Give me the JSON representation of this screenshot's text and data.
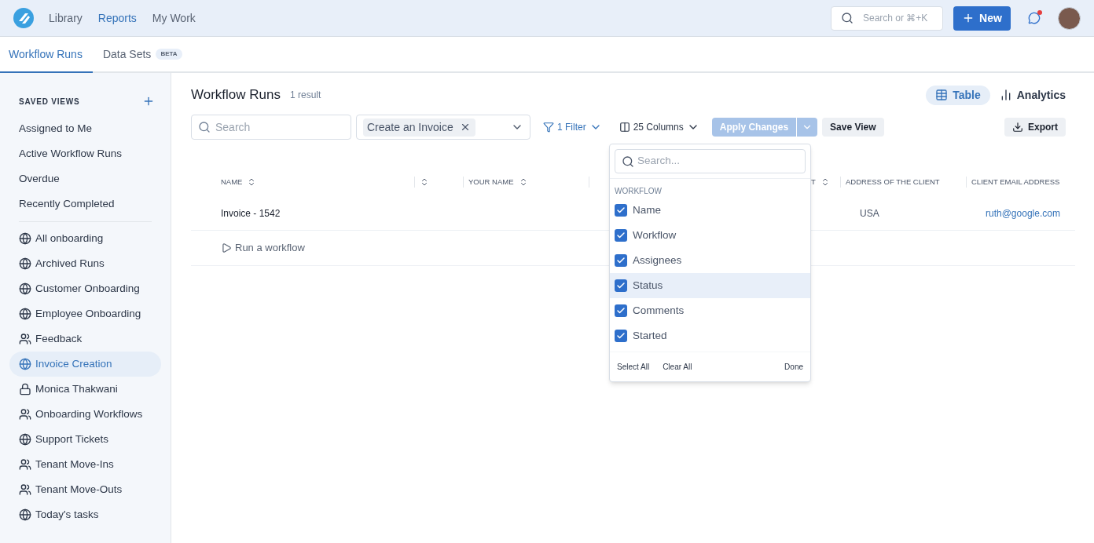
{
  "nav": {
    "items": [
      {
        "label": "Library",
        "selected": false
      },
      {
        "label": "Reports",
        "selected": true
      },
      {
        "label": "My Work",
        "selected": false
      }
    ],
    "search": {
      "placeholder": "Search or ⌘+K"
    },
    "new_button": "New",
    "messages": {
      "unread": true
    }
  },
  "tabs": [
    {
      "label": "Workflow Runs",
      "selected": true
    },
    {
      "label": "Data Sets",
      "selected": false,
      "badge": "BETA"
    }
  ],
  "sidebar": {
    "heading": "SAVED VIEWS",
    "groups": [
      [
        {
          "label": "Assigned to Me",
          "kind": "plain",
          "selected": false
        },
        {
          "label": "Active Workflow Runs",
          "kind": "plain",
          "selected": false
        },
        {
          "label": "Overdue",
          "kind": "plain",
          "selected": false
        },
        {
          "label": "Recently Completed",
          "kind": "plain",
          "selected": false
        }
      ],
      [
        {
          "label": "All onboarding",
          "kind": "globe",
          "selected": false
        },
        {
          "label": "Archived Runs",
          "kind": "globe",
          "selected": false
        },
        {
          "label": "Customer Onboarding",
          "kind": "globe",
          "selected": false
        },
        {
          "label": "Employee Onboarding",
          "kind": "globe",
          "selected": false
        },
        {
          "label": "Feedback",
          "kind": "people",
          "selected": false
        },
        {
          "label": "Invoice Creation",
          "kind": "globe",
          "selected": true
        },
        {
          "label": "Monica Thakwani",
          "kind": "lock",
          "selected": false
        },
        {
          "label": "Onboarding Workflows",
          "kind": "people",
          "selected": false
        },
        {
          "label": "Support Tickets",
          "kind": "globe",
          "selected": false
        },
        {
          "label": "Tenant Move-Ins",
          "kind": "people",
          "selected": false
        },
        {
          "label": "Tenant Move-Outs",
          "kind": "people",
          "selected": false
        },
        {
          "label": "Today's tasks",
          "kind": "globe",
          "selected": false
        }
      ]
    ]
  },
  "main": {
    "title": "Workflow Runs",
    "count": "1 result",
    "views": [
      {
        "label": "Table",
        "selected": true
      },
      {
        "label": "Analytics",
        "selected": false
      }
    ],
    "search": {
      "placeholder": "Search"
    },
    "workflow_filter": {
      "tag": "Create an Invoice"
    },
    "filter": "1 Filter",
    "columns_button": "25 Columns",
    "apply": {
      "label": "Apply Changes",
      "disabled": true
    },
    "save_view": "Save View",
    "export": "Export",
    "table": {
      "columns": [
        {
          "label": "NAME",
          "sortable": true
        },
        {
          "sortable": true
        },
        {
          "label": "YOUR NAME",
          "sortable": true
        },
        {
          "label": "T",
          "sortable": true
        },
        {
          "label": "ADDRESS OF THE CLIENT",
          "sortable": false
        },
        {
          "label": "CLIENT EMAIL ADDRESS",
          "sortable": false
        }
      ],
      "rows": [
        {
          "name": "Invoice - 1542",
          "address": "USA",
          "email": "ruth@google.com"
        }
      ],
      "run_link": "Run a workflow"
    },
    "column_menu": {
      "search": {
        "placeholder": "Search..."
      },
      "group": "WORKFLOW",
      "items": [
        {
          "label": "Name",
          "checked": true,
          "highlighted": false
        },
        {
          "label": "Workflow",
          "checked": true,
          "highlighted": false
        },
        {
          "label": "Assignees",
          "checked": true,
          "highlighted": false
        },
        {
          "label": "Status",
          "checked": true,
          "highlighted": true
        },
        {
          "label": "Comments",
          "checked": true,
          "highlighted": false
        },
        {
          "label": "Started",
          "checked": true,
          "highlighted": false
        }
      ],
      "select_all": "Select All",
      "clear_all": "Clear All",
      "done": "Done"
    }
  }
}
